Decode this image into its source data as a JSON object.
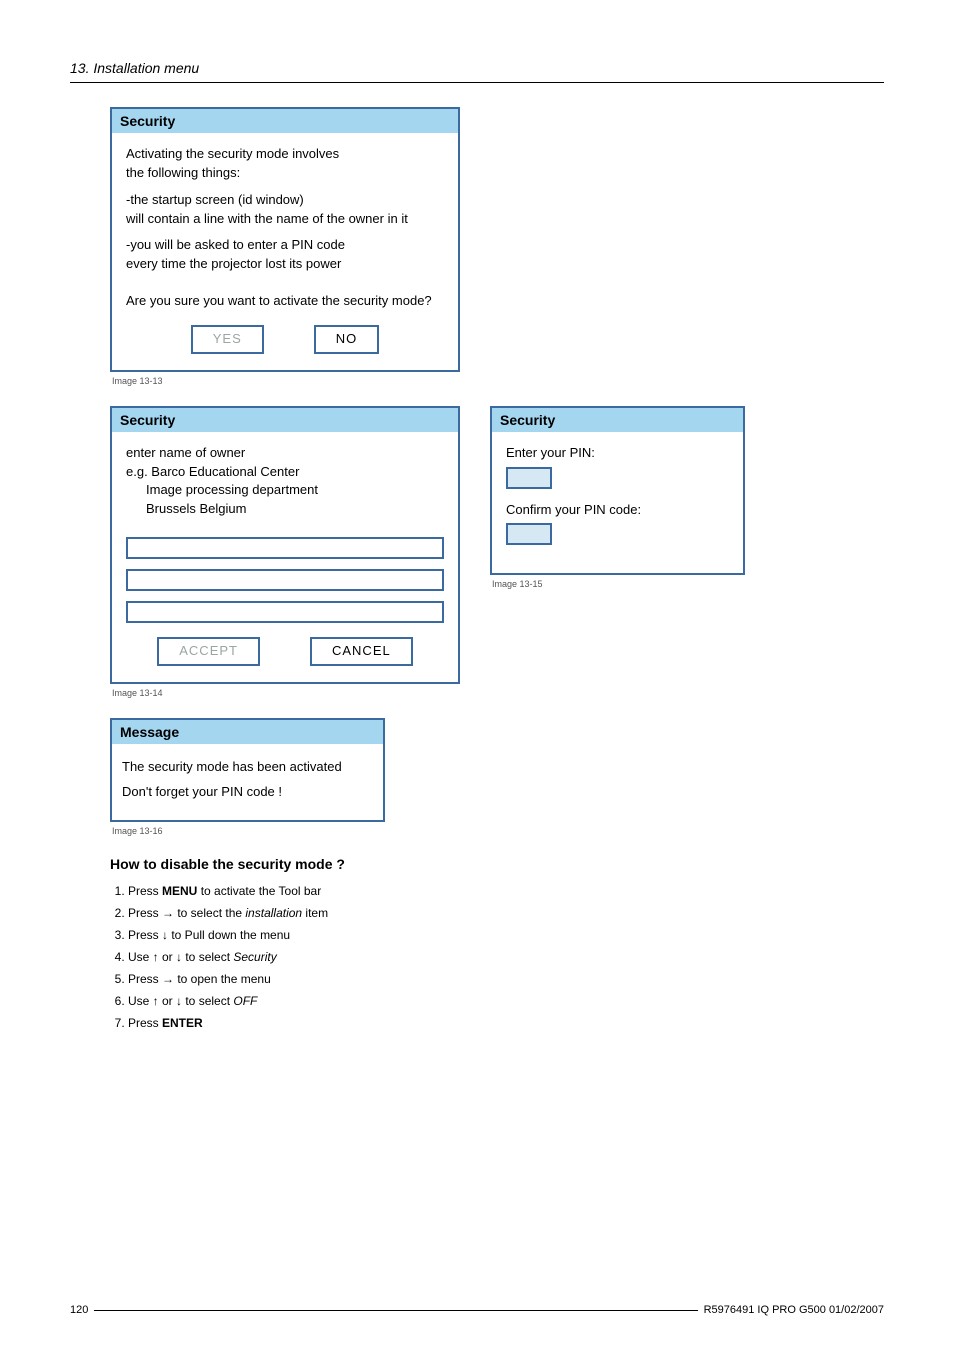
{
  "header": {
    "section": "13.  Installation menu"
  },
  "dialog1": {
    "title": "Security",
    "p1a": "Activating the security mode involves",
    "p1b": "the following things:",
    "p2a": "-the startup screen (id window)",
    "p2b": "will contain a line with the name of the owner in it",
    "p3a": "-you will be asked to enter a PIN code",
    "p3b": "every time the projector lost its power",
    "confirm": "Are you sure you want to activate the security mode?",
    "yes": "YES",
    "no": "NO",
    "caption": "Image 13-13"
  },
  "dialog2": {
    "title": "Security",
    "l1": "enter name of owner",
    "l2": "e.g.  Barco Educational Center",
    "l3": "Image processing department",
    "l4": "Brussels Belgium",
    "accept": "ACCEPT",
    "cancel": "CANCEL",
    "caption": "Image 13-14"
  },
  "dialog3": {
    "title": "Security",
    "enter": "Enter your PIN:",
    "confirm": "Confirm your PIN code:",
    "caption": "Image 13-15"
  },
  "dialog4": {
    "title": "Message",
    "l1": "The security mode has been activated",
    "l2": "Don't forget your PIN code !",
    "caption": "Image 13-16"
  },
  "howto": {
    "heading": "How to disable the security mode ?",
    "steps": {
      "s1_pre": "Press ",
      "s1_bold": "MENU",
      "s1_post": " to activate the Tool bar",
      "s2_pre": "Press → to select the ",
      "s2_it": "installation",
      "s2_post": " item",
      "s3": "Press ↓ to Pull down the menu",
      "s4_pre": "Use ↑ or ↓ to select ",
      "s4_it": "Security",
      "s5": "Press → to open the menu",
      "s6_pre": "Use ↑ or ↓ to select ",
      "s6_it": "OFF",
      "s7_pre": "Press ",
      "s7_bold": "ENTER"
    }
  },
  "footer": {
    "page": "120",
    "docref": "R5976491  IQ PRO G500  01/02/2007"
  }
}
